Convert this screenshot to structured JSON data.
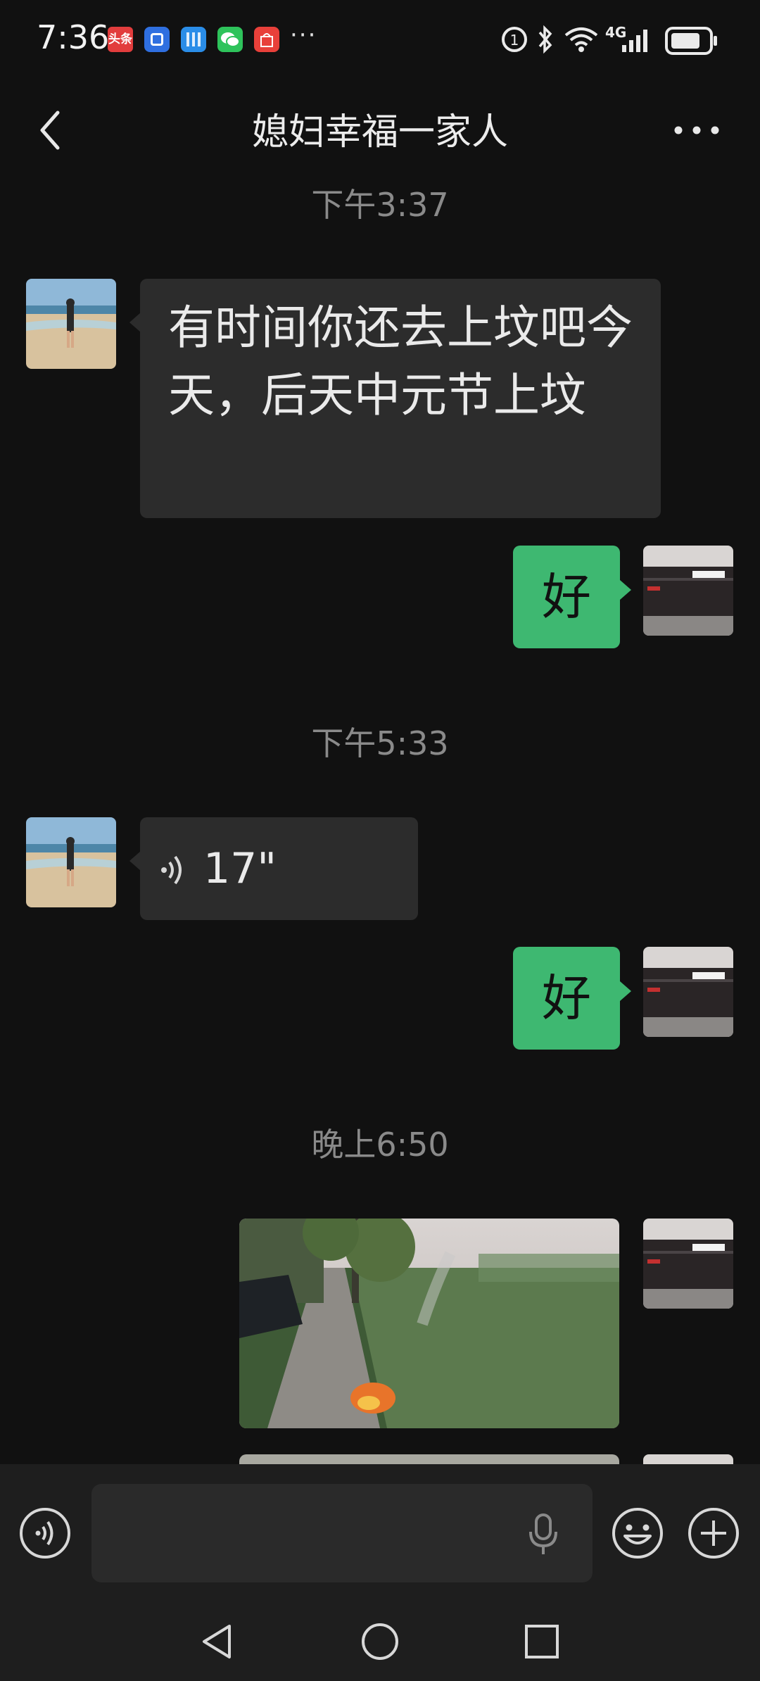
{
  "status_bar": {
    "time": "7:36",
    "more_notifications": "···",
    "network_label": "4G",
    "apps": [
      {
        "name": "toutiao-icon",
        "label": "头条",
        "color": "#e23d3d"
      },
      {
        "name": "wallet-icon",
        "color": "#2f6fe0"
      },
      {
        "name": "calendar-icon",
        "color": "#2a8de8"
      },
      {
        "name": "wechat-icon",
        "color": "#2ec35b"
      },
      {
        "name": "huawei-icon",
        "color": "#e8403a"
      }
    ]
  },
  "header": {
    "title": "媳妇幸福一家人"
  },
  "messages": {
    "t1": "下午3:37",
    "m1": "有时间你还去上坟吧今天，后天中元节上坟",
    "m2": "好",
    "t2": "下午5:33",
    "m3_duration": "17\"",
    "m4": "好",
    "t3": "晚上6:50"
  },
  "colors": {
    "background": "#111111",
    "incoming_bubble": "#2c2c2c",
    "outgoing_bubble": "#3eb871",
    "timestamp": "#8a8a8a"
  }
}
